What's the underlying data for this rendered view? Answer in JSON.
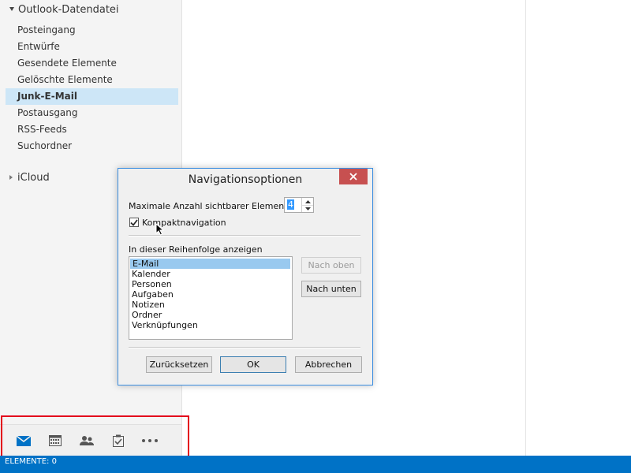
{
  "sidebar": {
    "account": "Outlook-Datendatei",
    "folders": [
      {
        "label": "Posteingang"
      },
      {
        "label": "Entwürfe"
      },
      {
        "label": "Gesendete Elemente"
      },
      {
        "label": "Gelöschte Elemente"
      },
      {
        "label": "Junk-E-Mail",
        "selected": true
      },
      {
        "label": "Postausgang"
      },
      {
        "label": "RSS-Feeds"
      },
      {
        "label": "Suchordner"
      }
    ],
    "icloud": "iCloud"
  },
  "navbar": {
    "icons": [
      "mail-icon",
      "calendar-icon",
      "people-icon",
      "tasks-icon",
      "more-icon"
    ],
    "active_color": "#0072c6"
  },
  "status": {
    "text": "ELEMENTE: 0"
  },
  "dialog": {
    "title": "Navigationsoptionen",
    "max_label": "Maximale Anzahl sichtbarer Elemente:",
    "max_value": "4",
    "compact_label": "Kompaktnavigation",
    "compact_checked": true,
    "order_label": "In dieser Reihenfolge anzeigen",
    "order_items": [
      "E-Mail",
      "Kalender",
      "Personen",
      "Aufgaben",
      "Notizen",
      "Ordner",
      "Verknüpfungen"
    ],
    "btn_up": "Nach oben",
    "btn_down": "Nach unten",
    "btn_reset": "Zurücksetzen",
    "btn_ok": "OK",
    "btn_cancel": "Abbrechen"
  },
  "colors": {
    "accent": "#0072c6",
    "highlight": "#e3001b",
    "close": "#c75050"
  }
}
